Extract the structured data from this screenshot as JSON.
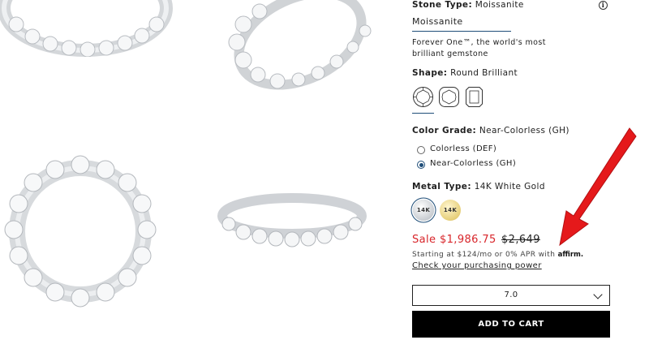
{
  "product": {
    "stone_type_label": "Stone Type:",
    "stone_type_value": "Moissanite",
    "stone_tab": "Moissanite",
    "stone_desc_line1": "Forever One™, the world's most",
    "stone_desc_line2": "brilliant gemstone",
    "shape_label": "Shape:",
    "shape_value": "Round Brilliant",
    "shapes": [
      "round-brilliant",
      "cushion",
      "emerald"
    ],
    "color_grade_label": "Color Grade:",
    "color_grade_value": "Near-Colorless (GH)",
    "color_options": [
      {
        "label": "Colorless (DEF)",
        "selected": false
      },
      {
        "label": "Near-Colorless (GH)",
        "selected": true
      }
    ],
    "metal_label": "Metal Type:",
    "metal_value": "14K White Gold",
    "metal_options": [
      {
        "label": "14K",
        "tone": "white",
        "selected": true
      },
      {
        "label": "14K",
        "tone": "yellow",
        "selected": false
      }
    ]
  },
  "pricing": {
    "sale_price": "Sale $1,986.75",
    "original_price": "$2,649",
    "financing_text": "Starting at $124/mo or 0% APR with",
    "affirm_logo": "affirm.",
    "power_link": "Check your purchasing power"
  },
  "size_select": {
    "value": "7.0"
  },
  "cart": {
    "button_label": "ADD TO CART"
  },
  "colors": {
    "accent": "#1f4e79",
    "sale": "#d8262b",
    "arrow": "#e5191b",
    "button": "#000000"
  }
}
